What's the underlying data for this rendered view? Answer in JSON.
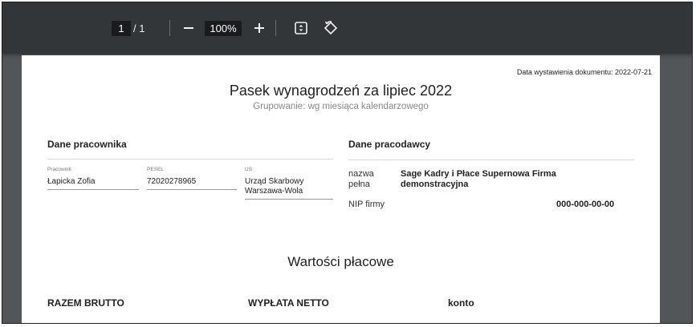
{
  "toolbar": {
    "current_page": "1",
    "page_separator": "/ 1",
    "zoom": "100%",
    "zoom_out_label": "−",
    "zoom_in_label": "+"
  },
  "document": {
    "issue_date": "Data wystawienia dokumentu: 2022-07-21",
    "title": "Pasek wynagrodzeń za lipiec 2022",
    "subtitle": "Grupowanie: wg miesiąca kalendarzowego",
    "employee_section": {
      "heading": "Dane pracownika",
      "fields": [
        {
          "label": "Pracownik",
          "value": "Łapicka Zofia"
        },
        {
          "label": "PESEL",
          "value": "72020278965"
        },
        {
          "label": "US",
          "value_line1": "Urząd Skarbowy",
          "value_line2": "Warszawa-Wola"
        }
      ]
    },
    "employer_section": {
      "heading": "Dane pracodawcy",
      "full_name_label_line1": "nazwa",
      "full_name_label_line2": "pełna",
      "full_name_value_line1": "Sage Kadry i Płace Supernowa Firma",
      "full_name_value_line2": "demonstracyjna",
      "nip_label": "NIP firmy",
      "nip_value": "000-000-00-00"
    },
    "values_section": {
      "heading": "Wartości płacowe",
      "columns": [
        "RAZEM BRUTTO",
        "WYPŁATA NETTO",
        "konto"
      ]
    }
  },
  "colors": {
    "toolbar_bg": "#323639",
    "viewer_bg": "#525659",
    "page_bg": "#ffffff"
  }
}
